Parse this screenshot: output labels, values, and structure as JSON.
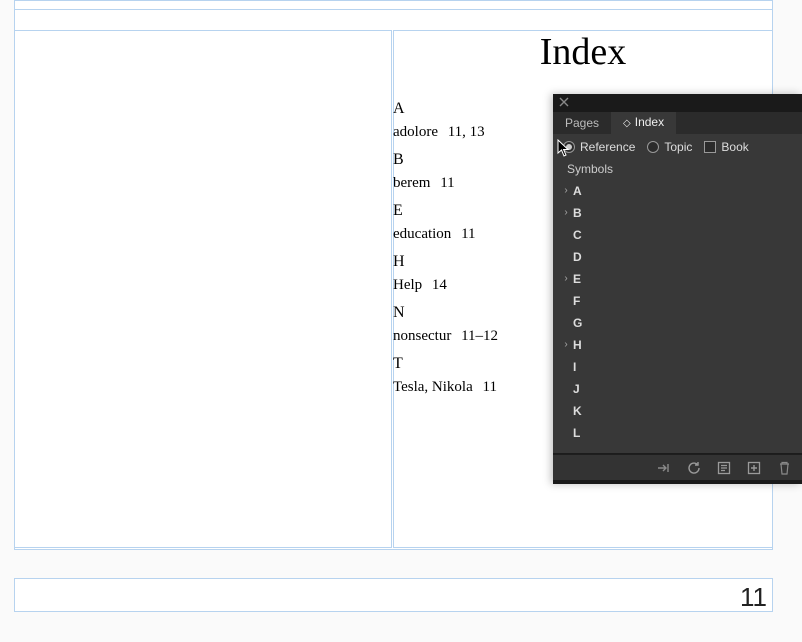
{
  "document": {
    "index_title": "Index",
    "page_number": "11",
    "sections": [
      {
        "letter": "A",
        "entries": [
          {
            "term": "adolore",
            "pages": "11, 13"
          }
        ]
      },
      {
        "letter": "B",
        "entries": [
          {
            "term": "berem",
            "pages": "11"
          }
        ]
      },
      {
        "letter": "E",
        "entries": [
          {
            "term": "education",
            "pages": "11"
          }
        ]
      },
      {
        "letter": "H",
        "entries": [
          {
            "term": "Help",
            "pages": "14"
          }
        ]
      },
      {
        "letter": "N",
        "entries": [
          {
            "term": "nonsectur",
            "pages": "11–12"
          }
        ]
      },
      {
        "letter": "T",
        "entries": [
          {
            "term": "Tesla, Nikola",
            "pages": "11"
          }
        ]
      }
    ]
  },
  "panel": {
    "tabs": {
      "pages": "Pages",
      "index": "Index"
    },
    "mode": {
      "reference": "Reference",
      "topic": "Topic",
      "book": "Book"
    },
    "symbols_label": "Symbols",
    "letters": [
      {
        "l": "A",
        "exp": true
      },
      {
        "l": "B",
        "exp": true
      },
      {
        "l": "C",
        "exp": false
      },
      {
        "l": "D",
        "exp": false
      },
      {
        "l": "E",
        "exp": true
      },
      {
        "l": "F",
        "exp": false
      },
      {
        "l": "G",
        "exp": false
      },
      {
        "l": "H",
        "exp": true
      },
      {
        "l": "I",
        "exp": false
      },
      {
        "l": "J",
        "exp": false
      },
      {
        "l": "K",
        "exp": false
      },
      {
        "l": "L",
        "exp": false
      }
    ]
  }
}
